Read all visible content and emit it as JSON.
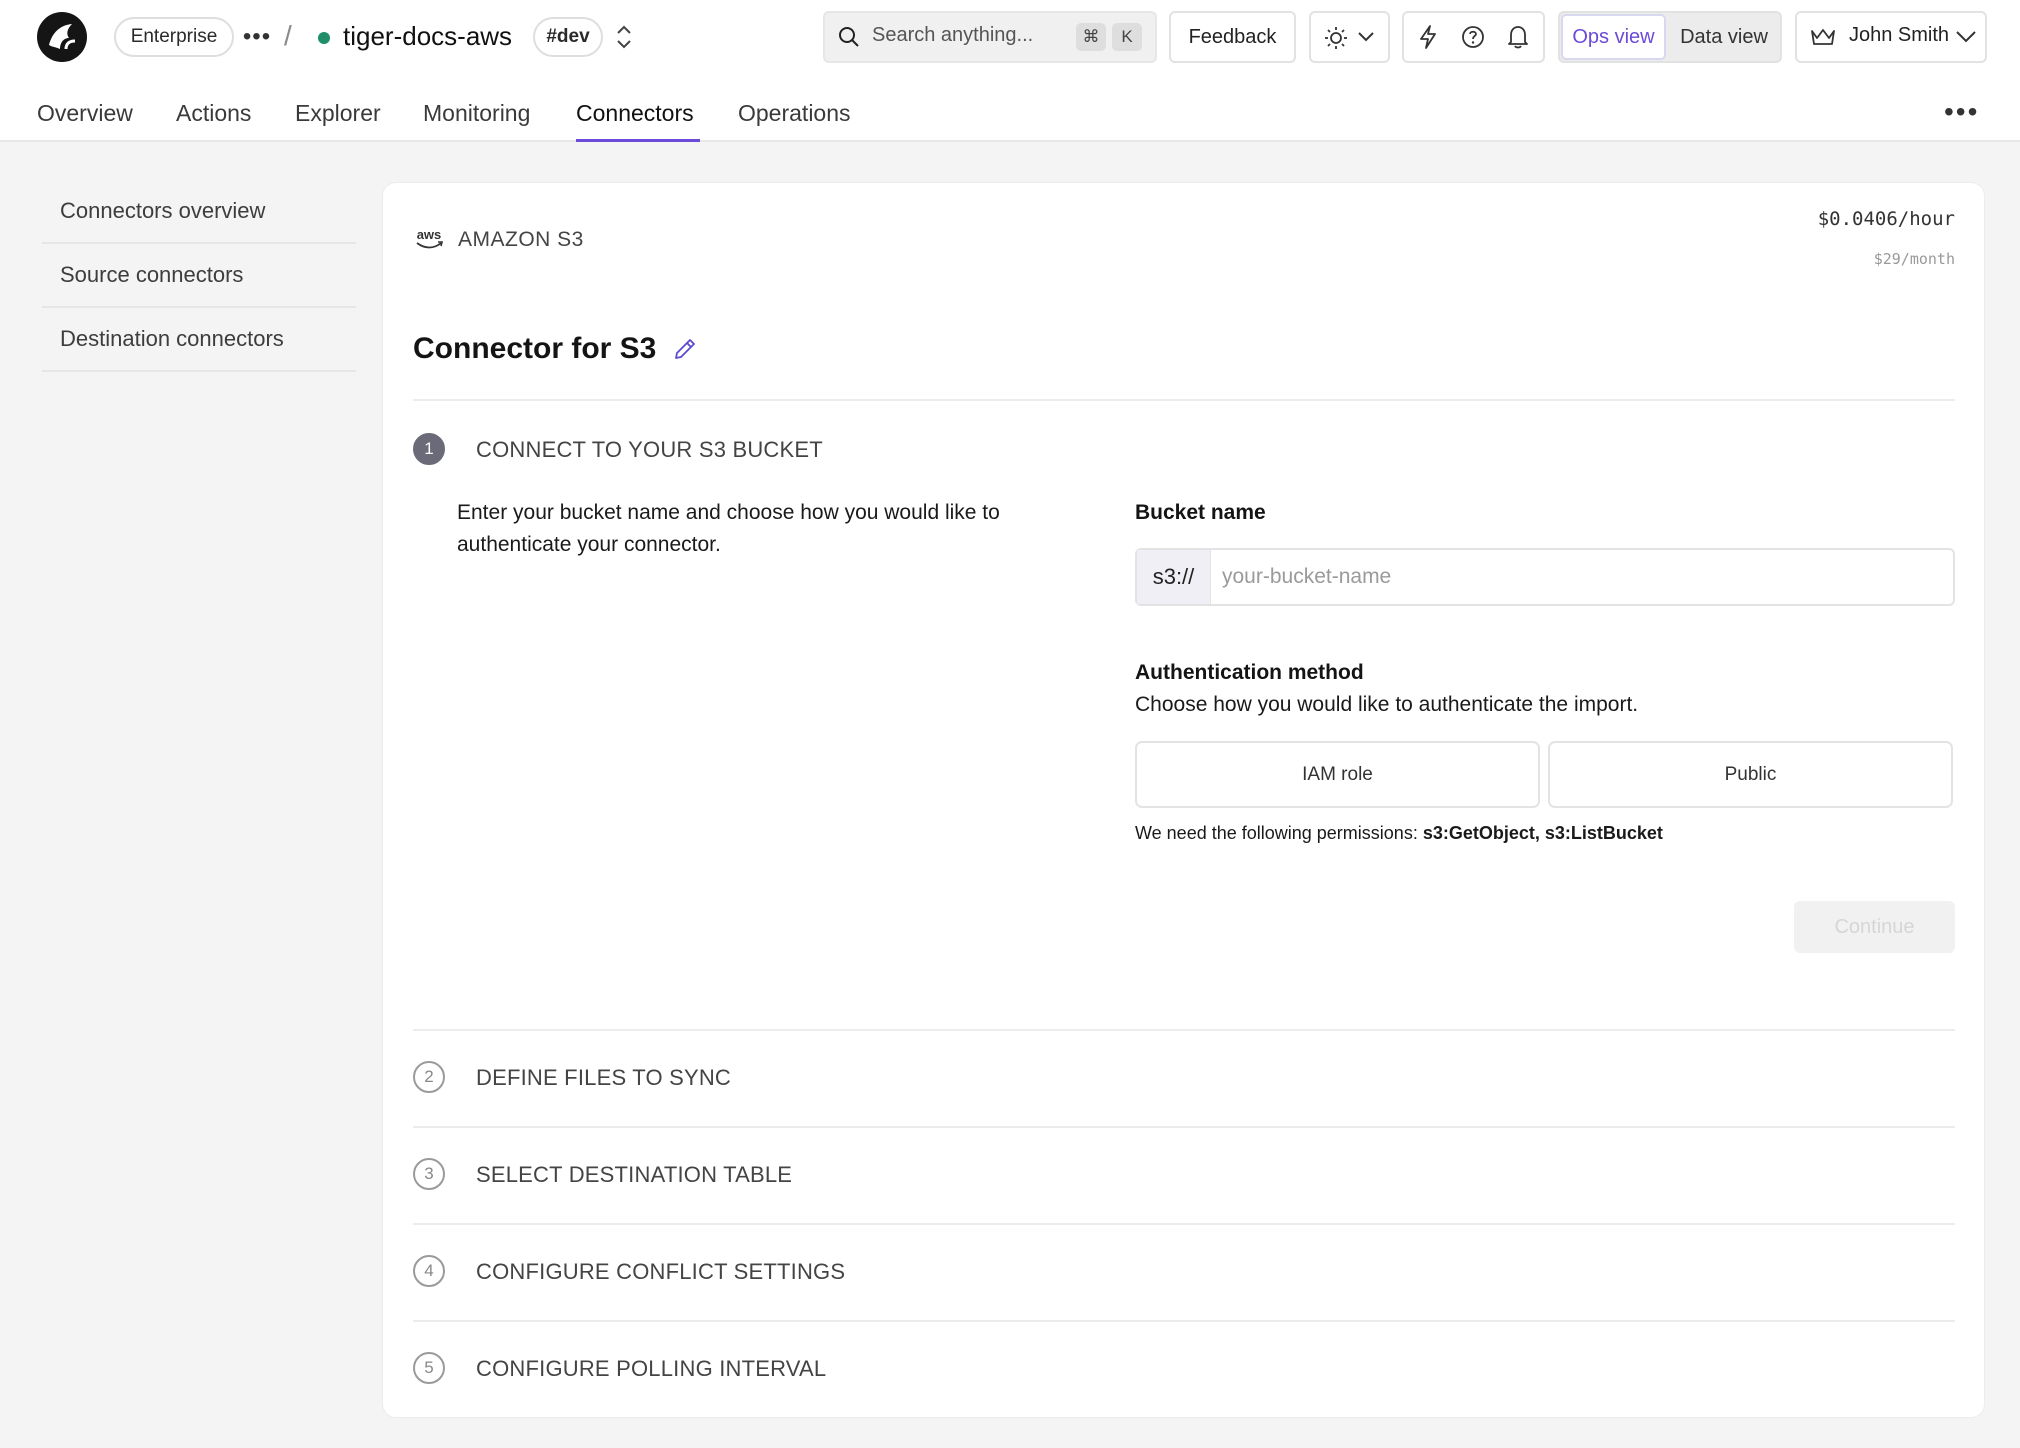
{
  "header": {
    "org_badge": "Enterprise",
    "breadcrumb_more": "•••",
    "breadcrumb_separator": "/",
    "project_name": "tiger-docs-aws",
    "env_tag": "#dev",
    "search": {
      "placeholder": "Search anything...",
      "shortcut_cmd": "⌘",
      "shortcut_key": "K"
    },
    "feedback_label": "Feedback",
    "view_toggle": {
      "ops": "Ops view",
      "data": "Data view"
    },
    "user_name": "John Smith"
  },
  "tabs": [
    {
      "label": "Overview"
    },
    {
      "label": "Actions"
    },
    {
      "label": "Explorer"
    },
    {
      "label": "Monitoring"
    },
    {
      "label": "Connectors"
    },
    {
      "label": "Operations"
    }
  ],
  "active_tab": "Connectors",
  "more_menu": "•••",
  "sidebar": {
    "items": [
      {
        "label": "Connectors overview"
      },
      {
        "label": "Source connectors"
      },
      {
        "label": "Destination connectors"
      }
    ]
  },
  "connector": {
    "provider_logo": "aws",
    "provider": "AMAZON S3",
    "price_hour": "$0.0406/hour",
    "price_month": "$29/month",
    "title": "Connector for S3",
    "steps": [
      {
        "number": "1",
        "title": "CONNECT TO YOUR S3 BUCKET"
      },
      {
        "number": "2",
        "title": "DEFINE FILES TO SYNC"
      },
      {
        "number": "3",
        "title": "SELECT DESTINATION TABLE"
      },
      {
        "number": "4",
        "title": "CONFIGURE CONFLICT SETTINGS"
      },
      {
        "number": "5",
        "title": "CONFIGURE POLLING INTERVAL"
      }
    ],
    "step1": {
      "description": "Enter your bucket name and choose how you would like to authenticate your connector.",
      "bucket_label": "Bucket name",
      "bucket_prefix": "s3://",
      "bucket_placeholder": "your-bucket-name",
      "bucket_value": "",
      "auth_label": "Authentication method",
      "auth_subtitle": "Choose how you would like to authenticate the import.",
      "auth_options": [
        {
          "label": "IAM role"
        },
        {
          "label": "Public"
        }
      ],
      "permissions_text": "We need the following permissions: ",
      "permissions_list": "s3:GetObject, s3:ListBucket",
      "continue_label": "Continue"
    }
  },
  "colors": {
    "accent": "#6b4bd8",
    "status_green": "#1f8f6a",
    "page_bg": "#f4f4f4",
    "card_bg": "#ffffff"
  },
  "icons": [
    "logo-icon",
    "chevron-updown-icon",
    "search-icon",
    "sun-icon",
    "chevron-down-icon",
    "bolt-icon",
    "help-icon",
    "bell-icon",
    "crown-icon",
    "pencil-icon"
  ]
}
